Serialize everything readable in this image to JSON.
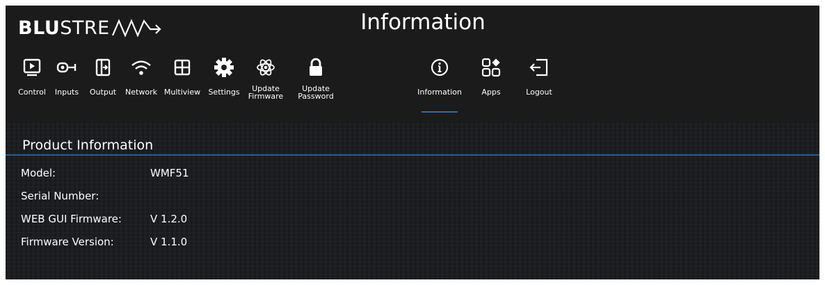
{
  "header": {
    "logo_bold": "BLU",
    "logo_light": "STRE",
    "title": "Information"
  },
  "nav": {
    "items": [
      {
        "label": "Control",
        "icon": "monitor-play-icon"
      },
      {
        "label": "Inputs",
        "icon": "input-plug-icon"
      },
      {
        "label": "Output",
        "icon": "output-arrow-icon"
      },
      {
        "label": "Network",
        "icon": "wifi-icon"
      },
      {
        "label": "Multiview",
        "icon": "grid-icon"
      },
      {
        "label": "Settings",
        "icon": "gear-icon"
      },
      {
        "label": "Update\nFirmware",
        "icon": "atom-icon"
      },
      {
        "label": "Update\nPassword",
        "icon": "lock-icon"
      },
      {
        "label": "Information",
        "icon": "info-icon",
        "active": true
      },
      {
        "label": "Apps",
        "icon": "apps-icon"
      },
      {
        "label": "Logout",
        "icon": "logout-icon"
      }
    ]
  },
  "main": {
    "section_title": "Product Information",
    "rows": [
      {
        "label": "Model:",
        "value": "WMF51"
      },
      {
        "label": "Serial Number:",
        "value": ""
      },
      {
        "label": "WEB GUI Firmware:",
        "value": "V 1.2.0"
      },
      {
        "label": "Firmware Version:",
        "value": "V 1.1.0"
      }
    ]
  },
  "colors": {
    "background": "#1e1e1e",
    "accent": "#2f6dab",
    "text": "#ffffff"
  }
}
